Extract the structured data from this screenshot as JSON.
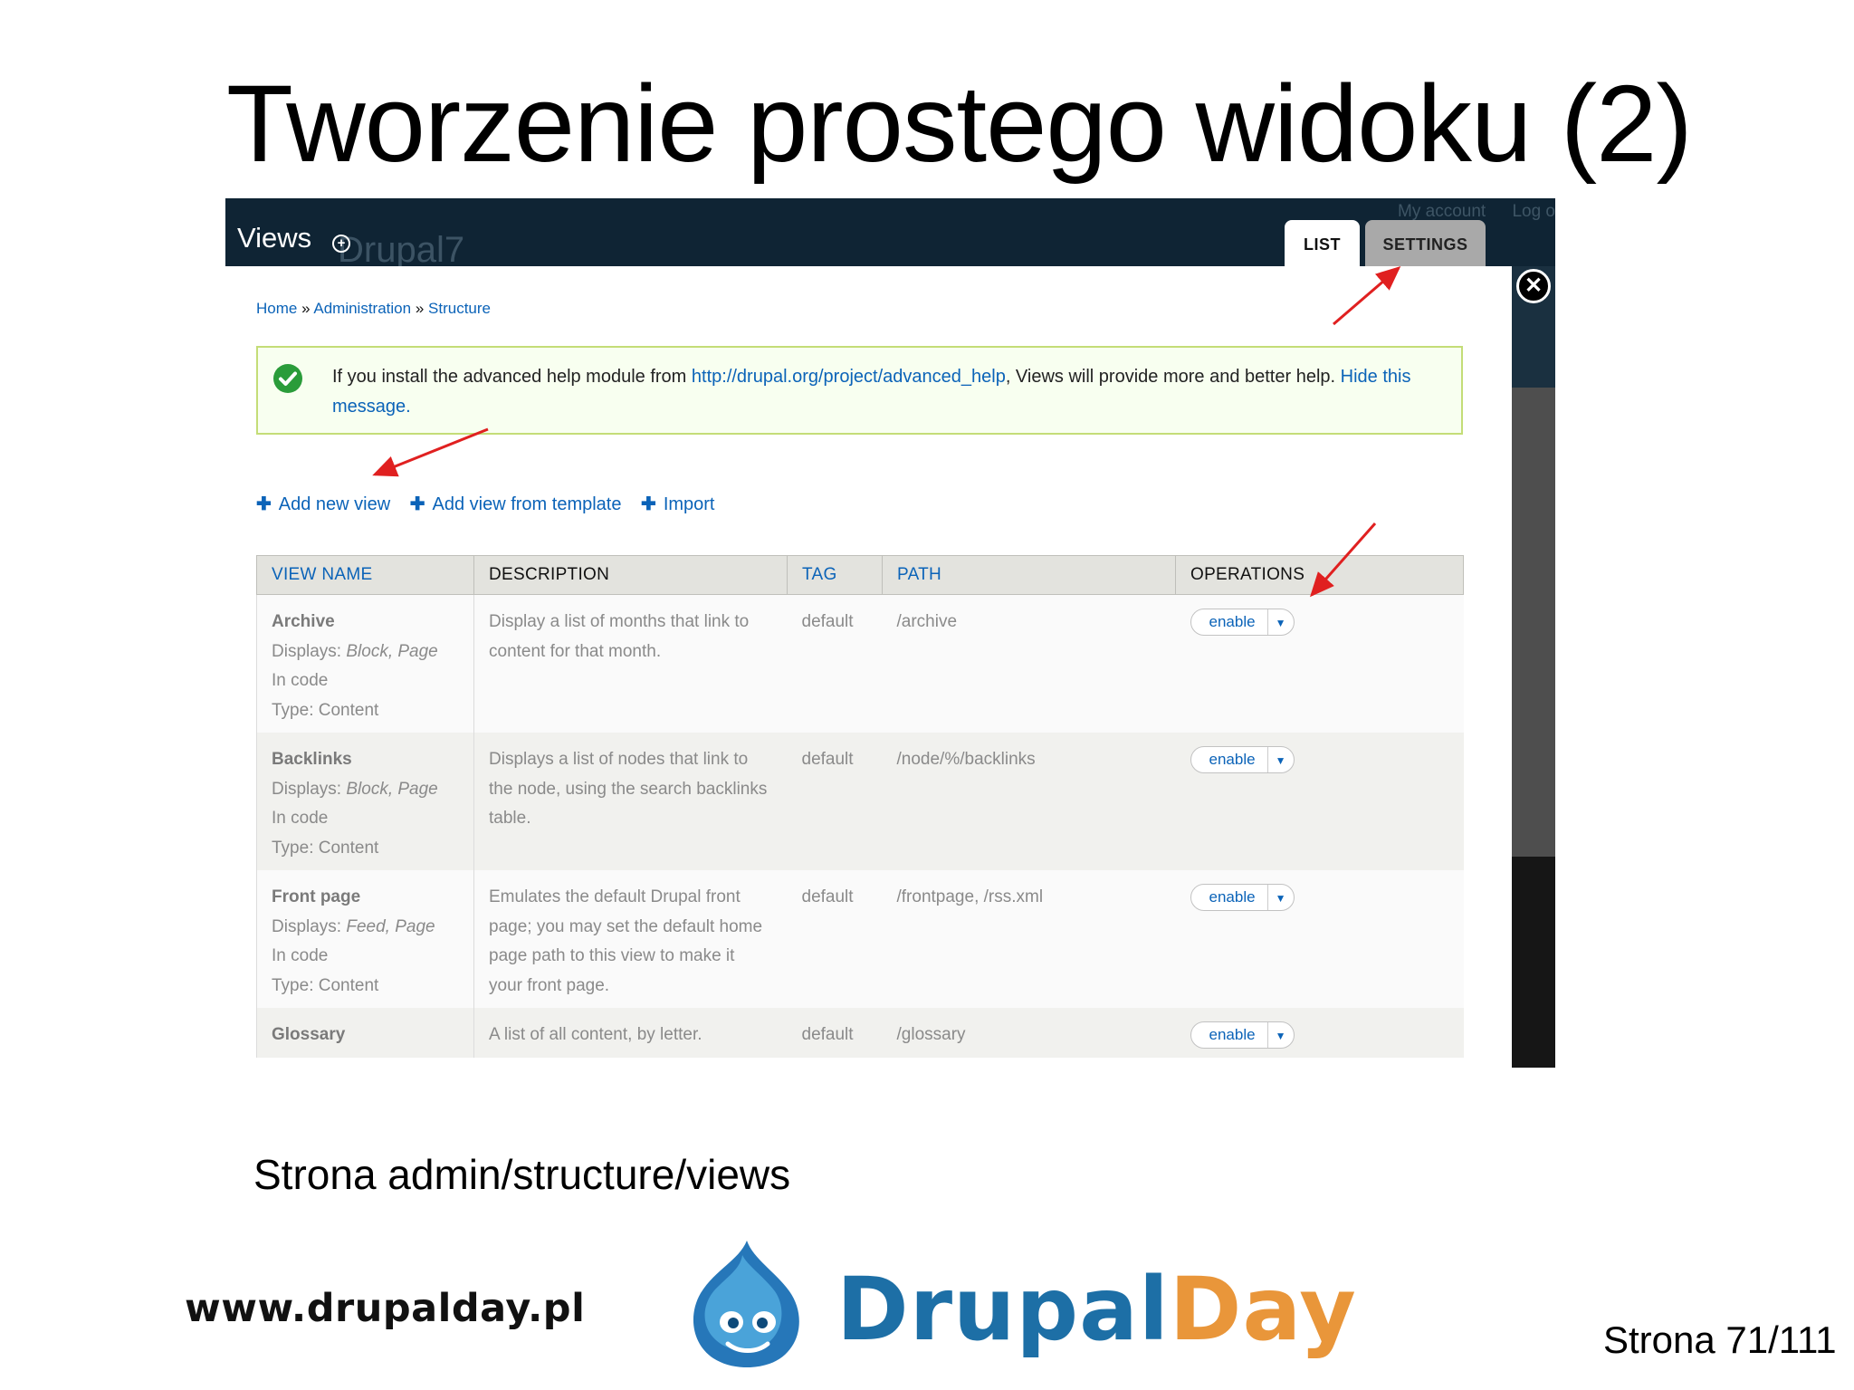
{
  "slide": {
    "title": "Tworzenie prostego widoku (2)",
    "caption": "Strona admin/structure/views",
    "site_url": "www.drupalday.pl",
    "brand_part1": "Drupal",
    "brand_part2": "Day",
    "page_number": "Strona 71/111"
  },
  "toolbar": {
    "title": "Views",
    "ghost_logo": "Drupal7",
    "user_links": [
      "My account",
      "Log o"
    ],
    "tabs": [
      {
        "label": "LIST",
        "active": true
      },
      {
        "label": "SETTINGS",
        "active": false
      }
    ]
  },
  "breadcrumb": {
    "items": [
      "Home",
      "Administration",
      "Structure"
    ],
    "separator": "»"
  },
  "message": {
    "text_before": "If you install the advanced help module from ",
    "link": "http://drupal.org/project/advanced_help",
    "text_after": ", Views will provide more and better help. ",
    "hide_link": "Hide this message."
  },
  "actions": [
    {
      "label": "Add new view"
    },
    {
      "label": "Add view from template"
    },
    {
      "label": "Import"
    }
  ],
  "table": {
    "headers": [
      "VIEW NAME",
      "DESCRIPTION",
      "TAG",
      "PATH",
      "OPERATIONS"
    ],
    "displays_prefix": "Displays: ",
    "rows": [
      {
        "name": "Archive",
        "displays": "Block, Page",
        "storage": "In code",
        "type": "Type: Content",
        "description": "Display a list of months that link to content for that month.",
        "tag": "default",
        "path": "/archive",
        "op": "enable"
      },
      {
        "name": "Backlinks",
        "displays": "Block, Page",
        "storage": "In code",
        "type": "Type: Content",
        "description": "Displays a list of nodes that link to the node, using the search backlinks table.",
        "tag": "default",
        "path": "/node/%/backlinks",
        "op": "enable"
      },
      {
        "name": "Front page",
        "displays": "Feed, Page",
        "storage": "In code",
        "type": "Type: Content",
        "description": "Emulates the default Drupal front page; you may set the default home page path to this view to make it your front page.",
        "tag": "default",
        "path": "/frontpage, /rss.xml",
        "op": "enable"
      },
      {
        "name": "Glossary",
        "displays": "",
        "storage": "",
        "type": "",
        "description": "A list of all content, by letter.",
        "tag": "default",
        "path": "/glossary",
        "op": "enable"
      }
    ]
  },
  "colors": {
    "toolbar_bg": "#0f2434",
    "link": "#0b63b8",
    "annotation_arrow": "#e02020",
    "brand_blue": "#1d6fa6",
    "brand_orange": "#e9963a"
  }
}
